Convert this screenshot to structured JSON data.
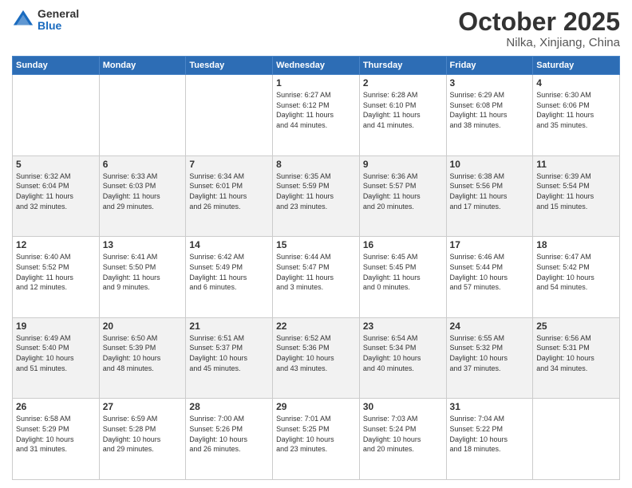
{
  "header": {
    "logo_general": "General",
    "logo_blue": "Blue",
    "month": "October 2025",
    "location": "Nilka, Xinjiang, China"
  },
  "calendar": {
    "days_of_week": [
      "Sunday",
      "Monday",
      "Tuesday",
      "Wednesday",
      "Thursday",
      "Friday",
      "Saturday"
    ],
    "weeks": [
      [
        {
          "day": "",
          "info": ""
        },
        {
          "day": "",
          "info": ""
        },
        {
          "day": "",
          "info": ""
        },
        {
          "day": "1",
          "info": "Sunrise: 6:27 AM\nSunset: 6:12 PM\nDaylight: 11 hours\nand 44 minutes."
        },
        {
          "day": "2",
          "info": "Sunrise: 6:28 AM\nSunset: 6:10 PM\nDaylight: 11 hours\nand 41 minutes."
        },
        {
          "day": "3",
          "info": "Sunrise: 6:29 AM\nSunset: 6:08 PM\nDaylight: 11 hours\nand 38 minutes."
        },
        {
          "day": "4",
          "info": "Sunrise: 6:30 AM\nSunset: 6:06 PM\nDaylight: 11 hours\nand 35 minutes."
        }
      ],
      [
        {
          "day": "5",
          "info": "Sunrise: 6:32 AM\nSunset: 6:04 PM\nDaylight: 11 hours\nand 32 minutes."
        },
        {
          "day": "6",
          "info": "Sunrise: 6:33 AM\nSunset: 6:03 PM\nDaylight: 11 hours\nand 29 minutes."
        },
        {
          "day": "7",
          "info": "Sunrise: 6:34 AM\nSunset: 6:01 PM\nDaylight: 11 hours\nand 26 minutes."
        },
        {
          "day": "8",
          "info": "Sunrise: 6:35 AM\nSunset: 5:59 PM\nDaylight: 11 hours\nand 23 minutes."
        },
        {
          "day": "9",
          "info": "Sunrise: 6:36 AM\nSunset: 5:57 PM\nDaylight: 11 hours\nand 20 minutes."
        },
        {
          "day": "10",
          "info": "Sunrise: 6:38 AM\nSunset: 5:56 PM\nDaylight: 11 hours\nand 17 minutes."
        },
        {
          "day": "11",
          "info": "Sunrise: 6:39 AM\nSunset: 5:54 PM\nDaylight: 11 hours\nand 15 minutes."
        }
      ],
      [
        {
          "day": "12",
          "info": "Sunrise: 6:40 AM\nSunset: 5:52 PM\nDaylight: 11 hours\nand 12 minutes."
        },
        {
          "day": "13",
          "info": "Sunrise: 6:41 AM\nSunset: 5:50 PM\nDaylight: 11 hours\nand 9 minutes."
        },
        {
          "day": "14",
          "info": "Sunrise: 6:42 AM\nSunset: 5:49 PM\nDaylight: 11 hours\nand 6 minutes."
        },
        {
          "day": "15",
          "info": "Sunrise: 6:44 AM\nSunset: 5:47 PM\nDaylight: 11 hours\nand 3 minutes."
        },
        {
          "day": "16",
          "info": "Sunrise: 6:45 AM\nSunset: 5:45 PM\nDaylight: 11 hours\nand 0 minutes."
        },
        {
          "day": "17",
          "info": "Sunrise: 6:46 AM\nSunset: 5:44 PM\nDaylight: 10 hours\nand 57 minutes."
        },
        {
          "day": "18",
          "info": "Sunrise: 6:47 AM\nSunset: 5:42 PM\nDaylight: 10 hours\nand 54 minutes."
        }
      ],
      [
        {
          "day": "19",
          "info": "Sunrise: 6:49 AM\nSunset: 5:40 PM\nDaylight: 10 hours\nand 51 minutes."
        },
        {
          "day": "20",
          "info": "Sunrise: 6:50 AM\nSunset: 5:39 PM\nDaylight: 10 hours\nand 48 minutes."
        },
        {
          "day": "21",
          "info": "Sunrise: 6:51 AM\nSunset: 5:37 PM\nDaylight: 10 hours\nand 45 minutes."
        },
        {
          "day": "22",
          "info": "Sunrise: 6:52 AM\nSunset: 5:36 PM\nDaylight: 10 hours\nand 43 minutes."
        },
        {
          "day": "23",
          "info": "Sunrise: 6:54 AM\nSunset: 5:34 PM\nDaylight: 10 hours\nand 40 minutes."
        },
        {
          "day": "24",
          "info": "Sunrise: 6:55 AM\nSunset: 5:32 PM\nDaylight: 10 hours\nand 37 minutes."
        },
        {
          "day": "25",
          "info": "Sunrise: 6:56 AM\nSunset: 5:31 PM\nDaylight: 10 hours\nand 34 minutes."
        }
      ],
      [
        {
          "day": "26",
          "info": "Sunrise: 6:58 AM\nSunset: 5:29 PM\nDaylight: 10 hours\nand 31 minutes."
        },
        {
          "day": "27",
          "info": "Sunrise: 6:59 AM\nSunset: 5:28 PM\nDaylight: 10 hours\nand 29 minutes."
        },
        {
          "day": "28",
          "info": "Sunrise: 7:00 AM\nSunset: 5:26 PM\nDaylight: 10 hours\nand 26 minutes."
        },
        {
          "day": "29",
          "info": "Sunrise: 7:01 AM\nSunset: 5:25 PM\nDaylight: 10 hours\nand 23 minutes."
        },
        {
          "day": "30",
          "info": "Sunrise: 7:03 AM\nSunset: 5:24 PM\nDaylight: 10 hours\nand 20 minutes."
        },
        {
          "day": "31",
          "info": "Sunrise: 7:04 AM\nSunset: 5:22 PM\nDaylight: 10 hours\nand 18 minutes."
        },
        {
          "day": "",
          "info": ""
        }
      ]
    ]
  }
}
